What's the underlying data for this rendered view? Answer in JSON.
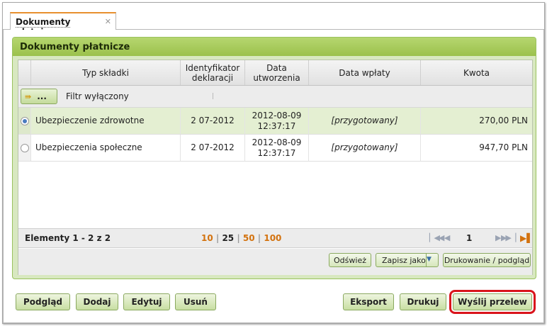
{
  "tab": {
    "label": "Dokumenty płatnicze",
    "close_glyph": "✕"
  },
  "panel": {
    "title": "Dokumenty płatnicze"
  },
  "grid": {
    "columns": [
      "Typ składki",
      "Identyfikator deklaracji",
      "Data utworzenia",
      "Data wpłaty",
      "Kwota"
    ],
    "filter": {
      "button_label": "...",
      "text": "Filtr wyłączony",
      "mark": "|"
    },
    "rows": [
      {
        "type": "Ubezpieczenie zdrowotne",
        "id": "2 07-2012",
        "created_date": "2012-08-09",
        "created_time": "12:37:17",
        "paid": "[przygotowany]",
        "amount": "270,00 PLN",
        "selected": true
      },
      {
        "type": "Ubezpieczenia społeczne",
        "id": "2 07-2012",
        "created_date": "2012-08-09",
        "created_time": "12:37:17",
        "paid": "[przygotowany]",
        "amount": "947,70 PLN",
        "selected": false
      }
    ]
  },
  "pager": {
    "count": "Elementy 1 - 2 z 2",
    "sizes": [
      "10",
      "25",
      "50",
      "100"
    ],
    "current_size": "25",
    "page": "1"
  },
  "grid_toolbar": {
    "refresh": "Odśwież",
    "save_as": "Zapisz jako",
    "print_preview": "Drukowanie / podgląd"
  },
  "actions": {
    "preview": "Podgląd",
    "add": "Dodaj",
    "edit": "Edytuj",
    "delete": "Usuń",
    "export": "Eksport",
    "print": "Drukuj",
    "send_transfer": "Wyślij przelew"
  },
  "colors": {
    "accent_green": "#9bc14c",
    "tab_top": "#e8902e",
    "highlight": "#d9141c",
    "page_size_link": "#d3720e"
  }
}
